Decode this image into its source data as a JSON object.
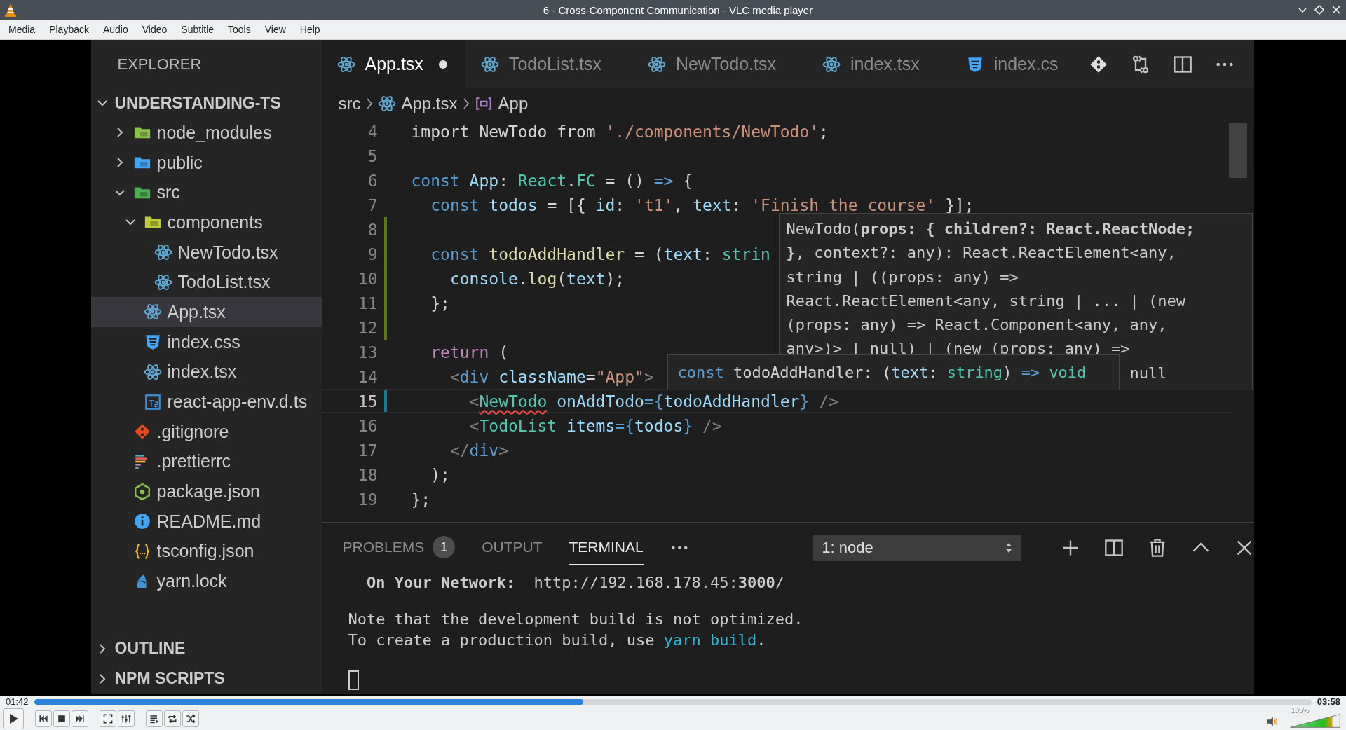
{
  "window": {
    "title": "6 - Cross-Component Communication - VLC media player"
  },
  "menu": [
    "Media",
    "Playback",
    "Audio",
    "Video",
    "Subtitle",
    "Tools",
    "View",
    "Help"
  ],
  "video": {
    "explorer": {
      "title": "EXPLORER",
      "project": {
        "label": "UNDERSTANDING-TS",
        "expanded": true
      },
      "tree": [
        {
          "name": "node_modules",
          "kind": "folder-node",
          "expanded": false,
          "selected": false
        },
        {
          "name": "public",
          "kind": "folder-public",
          "expanded": false,
          "selected": false
        },
        {
          "name": "src",
          "kind": "folder-src",
          "expanded": true,
          "selected": false,
          "children": [
            {
              "name": "components",
              "kind": "folder-components",
              "expanded": true,
              "selected": false,
              "children": [
                {
                  "name": "NewTodo.tsx",
                  "kind": "react",
                  "selected": false
                },
                {
                  "name": "TodoList.tsx",
                  "kind": "react",
                  "selected": false
                }
              ]
            },
            {
              "name": "App.tsx",
              "kind": "react",
              "selected": true
            },
            {
              "name": "index.css",
              "kind": "css",
              "selected": false
            },
            {
              "name": "index.tsx",
              "kind": "react",
              "selected": false
            },
            {
              "name": "react-app-env.d.ts",
              "kind": "ts",
              "selected": false
            }
          ]
        },
        {
          "name": ".gitignore",
          "kind": "git",
          "selected": false
        },
        {
          "name": ".prettierrc",
          "kind": "prettier",
          "selected": false
        },
        {
          "name": "package.json",
          "kind": "node",
          "selected": false
        },
        {
          "name": "README.md",
          "kind": "info",
          "selected": false
        },
        {
          "name": "tsconfig.json",
          "kind": "json",
          "selected": false
        },
        {
          "name": "yarn.lock",
          "kind": "yarn",
          "selected": false
        }
      ],
      "sections": [
        {
          "label": "OUTLINE",
          "expanded": false
        },
        {
          "label": "NPM SCRIPTS",
          "expanded": false
        }
      ]
    },
    "tabs": [
      {
        "label": "App.tsx",
        "kind": "react",
        "selected": true,
        "modified": true
      },
      {
        "label": "TodoList.tsx",
        "kind": "react",
        "selected": false,
        "modified": false
      },
      {
        "label": "NewTodo.tsx",
        "kind": "react",
        "selected": false,
        "modified": false
      },
      {
        "label": "index.tsx",
        "kind": "react",
        "selected": false,
        "modified": false
      },
      {
        "label": "index.cs",
        "kind": "css",
        "selected": false,
        "modified": false
      }
    ],
    "breadcrumb": [
      {
        "label": "src",
        "kind": "folder"
      },
      {
        "label": "App.tsx",
        "kind": "react"
      },
      {
        "label": "App",
        "kind": "symbol"
      }
    ],
    "lines": [
      {
        "number": "4",
        "current": false,
        "tokens": [
          {
            "text": "import NewTodo from ",
            "kind": "plain"
          },
          {
            "text": "'./components/NewTodo'",
            "kind": "str"
          },
          {
            "text": ";",
            "kind": "plain"
          }
        ]
      },
      {
        "number": "5",
        "current": false
      },
      {
        "number": "6",
        "current": false,
        "tokens": [
          {
            "text": "const ",
            "kind": "kw"
          },
          {
            "text": "App",
            "kind": "var"
          },
          {
            "text": ": ",
            "kind": "plain"
          },
          {
            "text": "React",
            "kind": "type"
          },
          {
            "text": ".",
            "kind": "plain"
          },
          {
            "text": "FC",
            "kind": "type"
          },
          {
            "text": " = () ",
            "kind": "plain"
          },
          {
            "text": "=>",
            "kind": "kw"
          },
          {
            "text": " {",
            "kind": "plain"
          }
        ]
      },
      {
        "number": "7",
        "current": false,
        "tokens": [
          {
            "text": "  const ",
            "kind": "kw"
          },
          {
            "text": "todos",
            "kind": "var"
          },
          {
            "text": " = [{ ",
            "kind": "plain"
          },
          {
            "text": "id",
            "kind": "var"
          },
          {
            "text": ": ",
            "kind": "plain"
          },
          {
            "text": "'t1'",
            "kind": "str"
          },
          {
            "text": ", ",
            "kind": "plain"
          },
          {
            "text": "text",
            "kind": "var"
          },
          {
            "text": ": ",
            "kind": "plain"
          },
          {
            "text": "'Finish the course'",
            "kind": "str"
          },
          {
            "text": " }];",
            "kind": "plain"
          }
        ]
      },
      {
        "number": "8",
        "current": false,
        "color": "#587c0c"
      },
      {
        "number": "9",
        "current": false,
        "color": "#587c0c",
        "tokens": [
          {
            "text": "  const ",
            "kind": "kw"
          },
          {
            "text": "todoAddHandler",
            "kind": "fn"
          },
          {
            "text": " = (",
            "kind": "plain"
          },
          {
            "text": "text",
            "kind": "var"
          },
          {
            "text": ": ",
            "kind": "plain"
          },
          {
            "text": "strin",
            "kind": "type"
          }
        ]
      },
      {
        "number": "10",
        "current": false,
        "color": "#587c0c",
        "tokens": [
          {
            "text": "    console",
            "kind": "var"
          },
          {
            "text": ".",
            "kind": "plain"
          },
          {
            "text": "log",
            "kind": "fn"
          },
          {
            "text": "(",
            "kind": "plain"
          },
          {
            "text": "text",
            "kind": "var"
          },
          {
            "text": ");",
            "kind": "plain"
          }
        ]
      },
      {
        "number": "11",
        "current": false,
        "color": "#587c0c",
        "tokens": [
          {
            "text": "  };",
            "kind": "plain"
          }
        ]
      },
      {
        "number": "12",
        "current": false,
        "color": "#587c0c"
      },
      {
        "number": "13",
        "current": false,
        "tokens": [
          {
            "text": "  return",
            "kind": "ctl"
          },
          {
            "text": " (",
            "kind": "plain"
          }
        ]
      },
      {
        "number": "14",
        "current": false,
        "tokens": [
          {
            "text": "    <",
            "kind": "punct"
          },
          {
            "text": "div",
            "kind": "kw"
          },
          {
            "text": " className",
            "kind": "var"
          },
          {
            "text": "=",
            "kind": "plain"
          },
          {
            "text": "\"App\"",
            "kind": "str"
          },
          {
            "text": ">",
            "kind": "punct"
          }
        ]
      },
      {
        "number": "15",
        "current": true,
        "color": "#0c7d9d",
        "tokens": [
          {
            "text": "      <",
            "kind": "punct"
          },
          {
            "text": "NewTodo",
            "kind": "error"
          },
          {
            "text": " onAddTodo",
            "kind": "var"
          },
          {
            "text": "={",
            "kind": "kw"
          },
          {
            "text": "todoAddHandler",
            "kind": "var"
          },
          {
            "text": "}",
            "kind": "kw"
          },
          {
            "text": " />",
            "kind": "punct"
          }
        ]
      },
      {
        "number": "16",
        "current": false,
        "tokens": [
          {
            "text": "      <",
            "kind": "punct"
          },
          {
            "text": "TodoList",
            "kind": "type"
          },
          {
            "text": " items",
            "kind": "var"
          },
          {
            "text": "={",
            "kind": "kw"
          },
          {
            "text": "todos",
            "kind": "var"
          },
          {
            "text": "}",
            "kind": "kw"
          },
          {
            "text": " />",
            "kind": "punct"
          }
        ]
      },
      {
        "number": "17",
        "current": false,
        "tokens": [
          {
            "text": "    </",
            "kind": "punct"
          },
          {
            "text": "div",
            "kind": "kw"
          },
          {
            "text": ">",
            "kind": "punct"
          }
        ]
      },
      {
        "number": "18",
        "current": false,
        "tokens": [
          {
            "text": "  );",
            "kind": "plain"
          }
        ]
      },
      {
        "number": "19",
        "current": false,
        "tokens": [
          {
            "text": "};",
            "kind": "plain"
          }
        ]
      }
    ],
    "hover": {
      "lines": [
        "NewTodo(**props: { children?: React.ReactNode;**",
        "**}**, context?: any): React.ReactElement<any,",
        "string | ((props: any) =>",
        "React.ReactElement<any, string | ... | (new",
        "(props: any) => React.Component<any, any,",
        "any>)> | null) | (new (props: any) =>"
      ],
      "tail": "null"
    },
    "signature": [
      {
        "text": "const",
        "kind": "kw"
      },
      {
        "text": " todoAddHandler: (",
        "kind": "plain"
      },
      {
        "text": "text",
        "kind": "var"
      },
      {
        "text": ": ",
        "kind": "plain"
      },
      {
        "text": "string",
        "kind": "type"
      },
      {
        "text": ") ",
        "kind": "plain"
      },
      {
        "text": "=> ",
        "kind": "kw"
      },
      {
        "text": "void",
        "kind": "type"
      }
    ],
    "panel": {
      "tabs": [
        {
          "label": "PROBLEMS",
          "count": "1",
          "selected": false
        },
        {
          "label": "OUTPUT",
          "selected": false
        },
        {
          "label": "TERMINAL",
          "selected": true
        }
      ],
      "terminal_select": "1: node",
      "terminal": [
        {
          "kind": "text",
          "segments": [
            {
              "text": "  On Your Network:",
              "kind": "bold"
            },
            {
              "text": "  http://192.168.178.45:",
              "kind": "plain"
            },
            {
              "text": "3000",
              "kind": "bold"
            },
            {
              "text": "/",
              "kind": "plain"
            }
          ]
        },
        {
          "kind": "blank"
        },
        {
          "kind": "text",
          "segments": [
            {
              "text": "Note that the development build is not optimized.",
              "kind": "plain"
            }
          ]
        },
        {
          "kind": "text",
          "segments": [
            {
              "text": "To create a production build, use ",
              "kind": "plain"
            },
            {
              "text": "yarn build",
              "kind": "command"
            },
            {
              "text": ".",
              "kind": "plain"
            }
          ]
        },
        {
          "kind": "blank"
        },
        {
          "kind": "cursor"
        }
      ]
    }
  },
  "player": {
    "elapsed": "01:42",
    "total": "03:58",
    "progress": {
      "level": 0.43
    },
    "volume": {
      "level": 0.84,
      "reading": "105%"
    }
  }
}
